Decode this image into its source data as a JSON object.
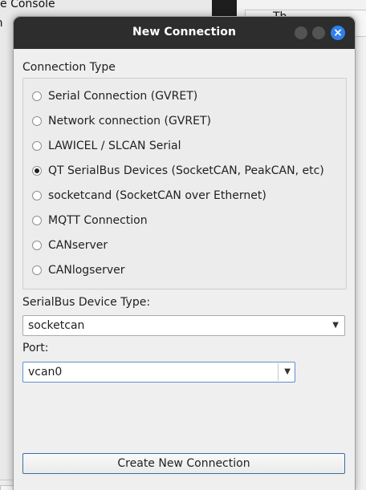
{
  "background": {
    "menu_items": [
      "e Console",
      "on"
    ],
    "right_text": "Th"
  },
  "dialog": {
    "title": "New Connection",
    "connection_type_label": "Connection Type",
    "connection_types": [
      {
        "label": "Serial Connection (GVRET)",
        "checked": false
      },
      {
        "label": "Network connection (GVRET)",
        "checked": false
      },
      {
        "label": "LAWICEL / SLCAN Serial",
        "checked": false
      },
      {
        "label": "QT SerialBus Devices (SocketCAN, PeakCAN, etc)",
        "checked": true
      },
      {
        "label": "socketcand (SocketCAN over Ethernet)",
        "checked": false
      },
      {
        "label": "MQTT Connection",
        "checked": false
      },
      {
        "label": "CANserver",
        "checked": false
      },
      {
        "label": "CANlogserver",
        "checked": false
      }
    ],
    "serialbus_label": "SerialBus Device Type:",
    "serialbus_value": "socketcan",
    "port_label": "Port:",
    "port_value": "vcan0",
    "create_button": "Create New Connection"
  },
  "icons": {
    "close": "close-icon",
    "dropdown": "chevron-down-icon"
  },
  "colors": {
    "titlebar": "#2d2d2d",
    "close_button": "#2f80ed",
    "focus_border": "#5f8fd0"
  }
}
